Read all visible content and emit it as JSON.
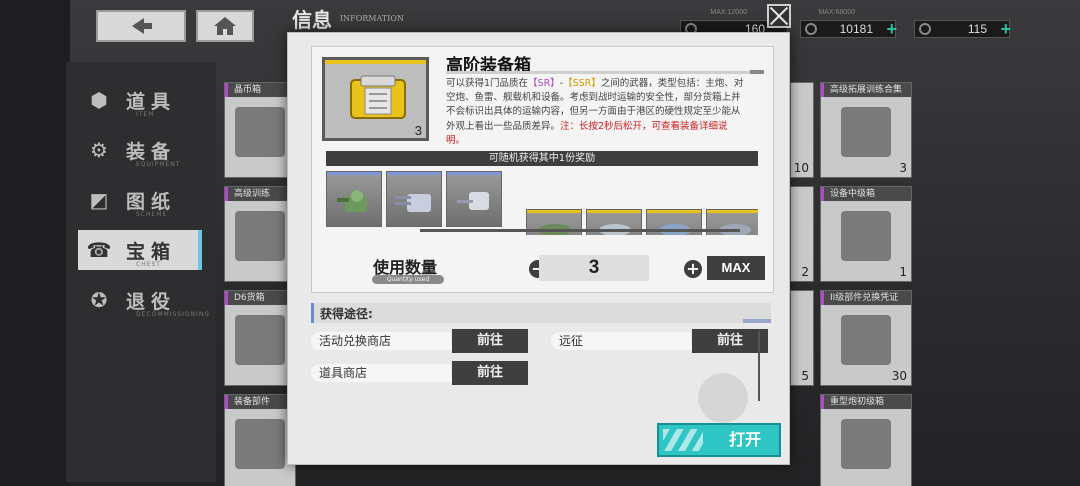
{
  "background": {
    "title": "信息",
    "title_en": "INFORMATION",
    "resources": [
      {
        "max": "MAX:12000",
        "value": "160"
      },
      {
        "max": "MAX:68000",
        "value": "10181"
      },
      {
        "max": "",
        "value": "115"
      }
    ],
    "categories": [
      {
        "label": "道具",
        "en": "ITEM",
        "icon": "cube-icon",
        "glyph": "⬢"
      },
      {
        "label": "装备",
        "en": "EQUIPMENT",
        "icon": "turret-icon",
        "glyph": "⚙"
      },
      {
        "label": "图纸",
        "en": "SCHEME",
        "icon": "blueprint-icon",
        "glyph": "◩"
      },
      {
        "label": "宝箱",
        "en": "CHEST",
        "icon": "chest-icon",
        "glyph": "☎"
      },
      {
        "label": "退役",
        "en": "DECOMMISSIONING",
        "icon": "medal-icon",
        "glyph": "✪"
      }
    ],
    "cards_left": [
      {
        "title": "晶币箱",
        "count": ""
      },
      {
        "title": "高级训练",
        "count": ""
      },
      {
        "title": "D6货箱",
        "count": ""
      },
      {
        "title": "装备部件",
        "count": ""
      }
    ],
    "cards_right": [
      {
        "title": "高级拓展训练合集",
        "count": "3"
      },
      {
        "title": "设备中级箱",
        "count": "1"
      },
      {
        "title": "II级部件兑换凭证",
        "count": "30"
      },
      {
        "title": "重型炮初级箱",
        "count": ""
      }
    ],
    "cards_mid_counts": [
      "10",
      "2",
      "5"
    ]
  },
  "modal": {
    "item_name": "高阶装备箱",
    "item_count": "3",
    "description": {
      "part1": "可以获得1门品质在",
      "sr": "【SR】",
      "dash": "-",
      "ssr": "【SSR】",
      "part2": "之间的武器，类型包括：主炮、对空炮、鱼雷、舰载机和设备。考虑到战时运输的安全性，部分货箱上并不会标识出具体的运输内容，但另一方面由于港区的硬性规定至少能从外观上看出一些品质差异。",
      "note": "注：长按2秒后松开，可查看装备详细说明。"
    },
    "reward_banner": "可随机获得其中1份奖励",
    "rewards": [
      {
        "icon": "green-turret-icon",
        "tier": "blue"
      },
      {
        "icon": "twin-gun-turret-icon",
        "tier": "blue"
      },
      {
        "icon": "aa-gun-icon",
        "tier": "blue"
      },
      {
        "icon": "torpedo-icon",
        "tier": "gold"
      },
      {
        "icon": "gun-mount-icon",
        "tier": "gold"
      },
      {
        "icon": "plane-icon",
        "tier": "gold"
      },
      {
        "icon": "equipment-icon",
        "tier": "gold"
      }
    ],
    "quantity": {
      "label": "使用数量",
      "label_en": "Quantity used",
      "value": "3",
      "minus": "−",
      "plus": "+",
      "max_label": "MAX"
    },
    "obtain": {
      "header": "获得途径:",
      "routes": [
        {
          "name": "活动兑换商店",
          "go": "前往"
        },
        {
          "name": "远征",
          "go": "前往"
        },
        {
          "name": "道具商店",
          "go": "前往"
        }
      ]
    },
    "open_label": "打开"
  },
  "colors": {
    "accent": "#2fc5c5",
    "sr": "#b04ac8",
    "ssr": "#d39a00",
    "warning": "#d21d1d"
  }
}
